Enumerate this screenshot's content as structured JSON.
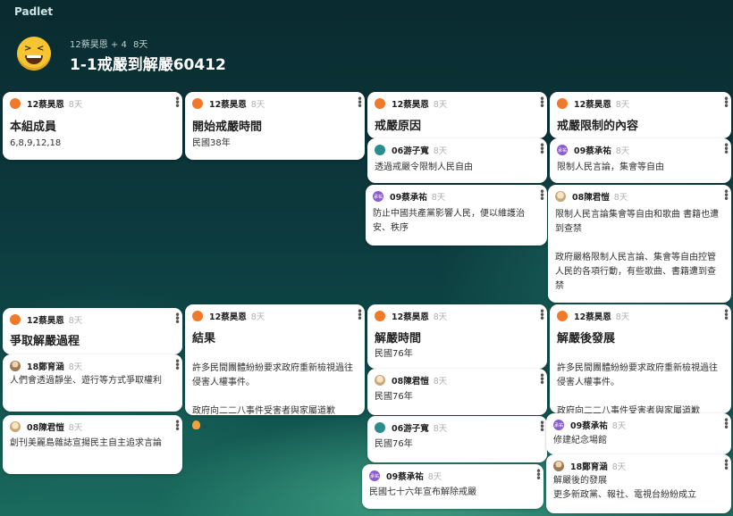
{
  "app": {
    "logo": "Padlet"
  },
  "board": {
    "owner": "12蔡昊恩",
    "collab": "+ 4",
    "age": "8天",
    "title": "1-1戒嚴到解嚴60412"
  },
  "cards": {
    "c1": {
      "author": "12蔡昊恩",
      "age": "8天",
      "title": "本組成員",
      "body": "6,8,9,12,18"
    },
    "c2": {
      "author": "12蔡昊恩",
      "age": "8天",
      "title": "開始戒嚴時間",
      "body": "民國38年"
    },
    "c3": {
      "author": "12蔡昊恩",
      "age": "8天",
      "title": "戒嚴原因"
    },
    "c3a": {
      "author": "06游子寬",
      "age": "8天",
      "body": "透過戒嚴令限制人民自由"
    },
    "c3b": {
      "author": "09蔡承祐",
      "age": "8天",
      "body": "防止中國共產黨影響人民，便以維護治安、秩序"
    },
    "c4": {
      "author": "12蔡昊恩",
      "age": "8天",
      "title": "戒嚴限制的內容"
    },
    "c4a": {
      "author": "09蔡承祐",
      "age": "8天",
      "body": "限制人民言論，集會等自由"
    },
    "c4b": {
      "author": "08陳君愷",
      "age": "8天",
      "body": "限制人民言論集會等自由和歌曲 書籍也遭到查禁\n\n政府嚴格限制人民言論、集會等自由控管人民的各項行動，有些歌曲、書籍遭到查禁"
    },
    "c5": {
      "author": "12蔡昊恩",
      "age": "8天",
      "title": "爭取解嚴過程"
    },
    "c5a": {
      "author": "18鄭育涵",
      "age": "8天",
      "body": "人們會透過靜坐、遊行等方式爭取權利"
    },
    "c5b": {
      "author": "08陳君愷",
      "age": "8天",
      "body": "創刊美麗島雜誌宣揚民主自主追求言論"
    },
    "c6": {
      "author": "12蔡昊恩",
      "age": "8天",
      "title": "結果",
      "body1": "許多民間團體紛紛要求政府重新檢視過往侵害人權事件。",
      "body2": "政府向二二八事件受害者與家屬道歉"
    },
    "c7": {
      "author": "12蔡昊恩",
      "age": "8天",
      "title": "解嚴時間",
      "body": "民國76年"
    },
    "c7a": {
      "author": "08陳君愷",
      "age": "8天",
      "body": "民國76年"
    },
    "c7b": {
      "author": "06游子寬",
      "age": "8天",
      "body": "民國76年"
    },
    "c7c": {
      "author": "09蔡承祐",
      "age": "8天",
      "body": "民國七十六年宣布解除戒嚴"
    },
    "c8": {
      "author": "12蔡昊恩",
      "age": "8天",
      "title": "解嚴後發展",
      "body1": "許多民間團體紛紛要求政府重新檢視過往侵害人權事件。",
      "body2": "政府向二二八事件受害者與家屬道歉"
    },
    "c8a": {
      "author": "09蔡承祐",
      "age": "8天",
      "body": "修建紀念場館"
    },
    "c8b": {
      "author": "18鄭育涵",
      "age": "8天",
      "body": "解嚴後的發展\n更多新政黨、報社、電視台紛紛成立"
    }
  },
  "colors": {
    "accent_orange": "#f07a2a",
    "accent_purple": "#8a5ccf"
  }
}
